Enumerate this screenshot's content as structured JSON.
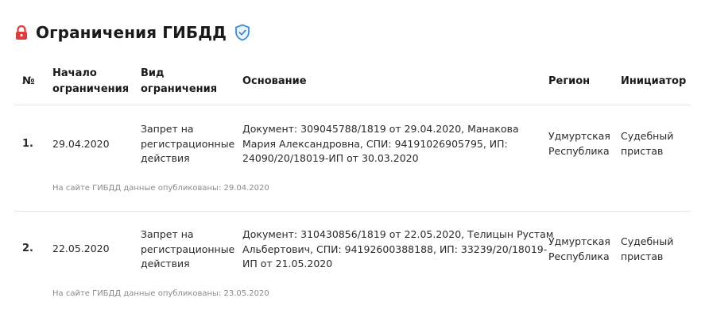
{
  "section": {
    "title": "Ограничения ГИБДД",
    "lock_icon": "lock-icon",
    "badge_icon": "shield-check-icon",
    "accent": "#e03b3b",
    "badge_color": "#3a8fd9"
  },
  "table": {
    "headers": {
      "num": "№",
      "start_line1": "Начало",
      "start_line2": "ограничения",
      "type_line1": "Вид",
      "type_line2": "ограничения",
      "basis": "Основание",
      "region": "Регион",
      "initiator": "Инициатор"
    },
    "rows": [
      {
        "num": "1.",
        "date": "29.04.2020",
        "type_lines": [
          "Запрет на",
          "регистрационные",
          "действия"
        ],
        "basis_lines": [
          "Документ: 309045788/1819 от 29.04.2020, Манакова",
          "Мария Александровна, СПИ: 94191026905795, ИП:",
          "24090/20/18019-ИП от 30.03.2020"
        ],
        "region_lines": [
          "Удмуртская",
          "Республика"
        ],
        "initiator_lines": [
          "Судебный",
          "пристав"
        ],
        "published": "На сайте ГИБДД данные опубликованы: 29.04.2020"
      },
      {
        "num": "2.",
        "date": "22.05.2020",
        "type_lines": [
          "Запрет на",
          "регистрационные",
          "действия"
        ],
        "basis_lines": [
          "Документ: 310430856/1819 от 22.05.2020, Телицын Рустам",
          "Альбертович, СПИ: 94192600388188, ИП: 33239/20/18019-",
          "ИП от 21.05.2020"
        ],
        "region_lines": [
          "Удмуртская",
          "Республика"
        ],
        "initiator_lines": [
          "Судебный",
          "пристав"
        ],
        "published": "На сайте ГИБДД данные опубликованы: 23.05.2020"
      }
    ]
  }
}
